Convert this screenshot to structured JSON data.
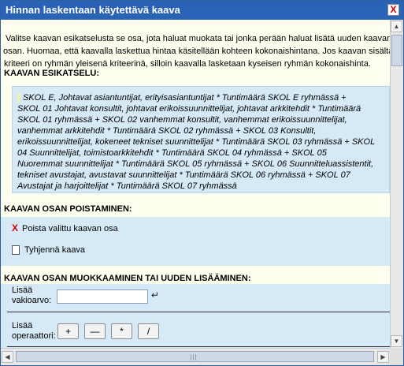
{
  "window": {
    "title": "Hinnan laskentaan käytettävä kaava",
    "close_label": "X"
  },
  "intro": {
    "line1": "Valitse kaavan esikatselusta se osa, jota haluat muokata tai jonka perään haluat lisätä uuden kaavan",
    "line2": "osan. Huomaa, että kaavalla laskettua hintaa käsitellään kohteen kokonaishintana. Jos kaavan sisältä",
    "line3": "kriteeri on ryhmän yleisenä kriteerinä, silloin kaavalla lasketaan kyseisen ryhmän kokonaishinta."
  },
  "preview": {
    "title": "KAAVAN ESIKATSELU:",
    "lines": [
      "SKOL E, Johtavat asiantuntijat, erityisasiantuntijat  *   Tuntimäärä SKOL E ryhmässä  +",
      "SKOL 01 Johtavat konsultit, johtavat erikoissuunnittelijat, johtavat arkkitehdit  *   Tuntimäärä",
      "SKOL 01 ryhmässä  +   SKOL 02 vanhemmat konsultit, vanhemmat erikoissuunnittelijat,",
      "vanhemmat arkkitehdit  *   Tuntimäärä SKOL 02 ryhmässä  +   SKOL 03 Konsultit,",
      "erikoissuunnittelijat, kokeneet tekniset suunnittelijat  *   Tuntimäärä SKOL 03 ryhmässä  +   SKOL",
      "04 Suunnittelijat, toimistoarkkitehdit  *   Tuntimäärä SKOL 04 ryhmässä  +   SKOL 05",
      "Nuoremmat suunnittelijat  *   Tuntimäärä SKOL 05 ryhmässä  +   SKOL 06 Suunnitteluassistentit,",
      "tekniset avustajat, avustavat suunnittelijat  *   Tuntimäärä SKOL 06 ryhmässä  +   SKOL 07",
      "Avustajat ja harjoittelijat  *   Tuntimäärä SKOL 07 ryhmässä"
    ]
  },
  "remove": {
    "title": "KAAVAN OSAN POISTAMINEN:",
    "delete_label": "Poista valittu kaavan osa",
    "clear_label": "Tyhjennä kaava"
  },
  "edit": {
    "title": "KAAVAN OSAN MUOKKAAMINEN TAI UUDEN LISÄÄMINEN:",
    "constant_label_1": "Lisää",
    "constant_label_2": "vakioarvo:",
    "constant_value": "",
    "operator_label_1": "Lisää",
    "operator_label_2": "operaattori:",
    "operators": [
      "+",
      "—",
      "*",
      "/"
    ]
  },
  "colors": {
    "titlebar": "#2a62b5",
    "panel": "#d6e9f7",
    "background": "#fffff0",
    "close_x": "#cc0000"
  },
  "icons": {
    "delete": "x-icon",
    "clear": "document-icon",
    "enter": "enter-arrow-icon"
  }
}
